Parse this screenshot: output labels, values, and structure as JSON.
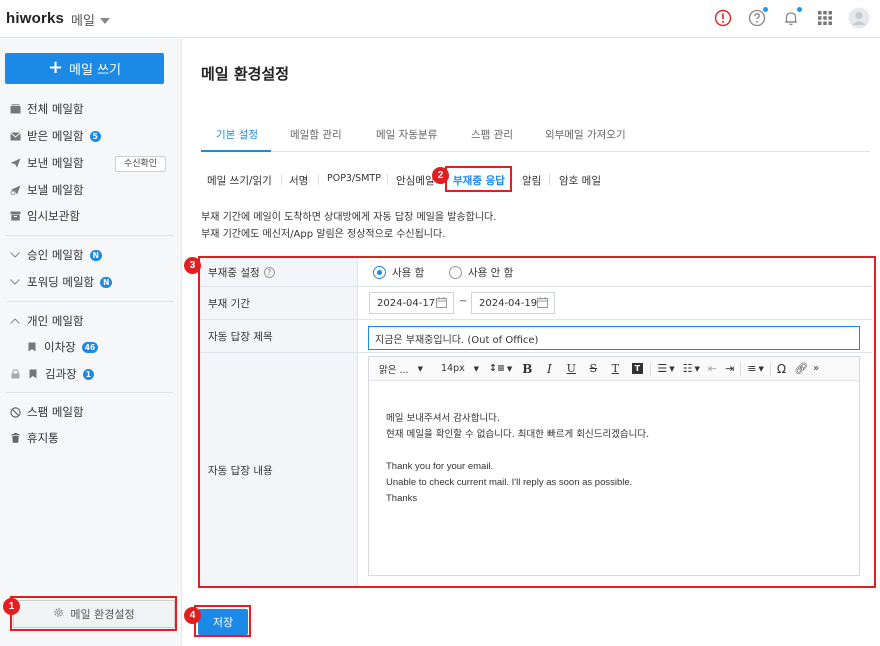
{
  "header": {
    "logo": "hiworks",
    "app_name": "메일",
    "icons": [
      "alert-icon",
      "help-icon",
      "bell-icon",
      "apps-grid-icon",
      "user-avatar-icon"
    ]
  },
  "sidebar": {
    "compose_label": "메일 쓰기",
    "items": [
      {
        "label": "전체 메일함",
        "icon": "envelope-stack-icon"
      },
      {
        "label": "받은 메일함",
        "icon": "envelope-icon",
        "badge": "5"
      },
      {
        "label": "보낸 메일함",
        "icon": "send-icon",
        "button": "수신확인"
      },
      {
        "label": "보낼 메일함",
        "icon": "send-scheduled-icon"
      },
      {
        "label": "임시보관함",
        "icon": "archive-icon"
      },
      {
        "label": "승인 메일함",
        "icon": "chevron-down-icon",
        "badge": "N"
      },
      {
        "label": "포워딩 메일함",
        "icon": "chevron-down-icon",
        "badge": "N"
      },
      {
        "label": "개인 메일함",
        "icon": "chevron-up-icon"
      },
      {
        "label": "이차장",
        "icon": "bookmark-icon",
        "badge": "46"
      },
      {
        "label": "김과장",
        "icon": "bookmark-icon",
        "badge": "1"
      },
      {
        "label": "스팸 메일함",
        "icon": "ban-icon"
      },
      {
        "label": "휴지통",
        "icon": "trash-icon"
      }
    ],
    "settings_label": "메일 환경설정"
  },
  "main": {
    "title": "메일 환경설정",
    "tabs": [
      {
        "label": "기본 설정",
        "active": true
      },
      {
        "label": "메일함 관리"
      },
      {
        "label": "메일 자동분류"
      },
      {
        "label": "스팸 관리"
      },
      {
        "label": "외부메일 가져오기"
      }
    ],
    "subtabs": [
      {
        "label": "메일 쓰기/읽기"
      },
      {
        "label": "서명"
      },
      {
        "label": "POP3/SMTP"
      },
      {
        "label": "안심메일"
      },
      {
        "label": "부재중 응답",
        "active": true
      },
      {
        "label": "알림"
      },
      {
        "label": "암호 메일"
      }
    ],
    "desc_line1": "부재 기간에 메일이 도착하면 상대방에게 자동 답장 메일을 발송합니다.",
    "desc_line2": "부재 기간에도 메신저/App 알림은 정상적으로 수신됩니다.",
    "form": {
      "status_label": "부재중 설정",
      "radio_use": "사용 함",
      "radio_nouse": "사용 안 함",
      "radio_selected": "사용 함",
      "period_label": "부재 기간",
      "date_from": "2024-04-17",
      "date_sep": "~",
      "date_to": "2024-04-19",
      "subject_label": "자동 답장 제목",
      "subject_value": "지금은 부재중입니다. (Out of Office)",
      "content_label": "자동 답장 내용",
      "toolbar": {
        "font": "맑은 ...",
        "size": "14px",
        "items": [
          "line-height-icon",
          "bold-icon",
          "italic-icon",
          "underline-icon",
          "strikethrough-icon",
          "text-color-icon",
          "background-color-icon",
          "bullet-list-icon",
          "numbered-list-icon",
          "outdent-icon",
          "indent-icon",
          "align-icon",
          "special-char-icon",
          "link-icon",
          "more-icon"
        ]
      },
      "content_lines": [
        "메일 보내주셔서 감사합니다.",
        "현재 메일을 확인할 수 없습니다. 최대한 빠르게 회신드리겠습니다.",
        "",
        "Thank you for your email.",
        "Unable to check current mail. I'll reply as soon as possible.",
        "Thanks"
      ]
    },
    "save_label": "저장"
  },
  "callouts": [
    "1",
    "2",
    "3",
    "4"
  ],
  "colors": {
    "accent": "#1a8ae6",
    "callout": "#e02020",
    "alert": "#e02020"
  }
}
